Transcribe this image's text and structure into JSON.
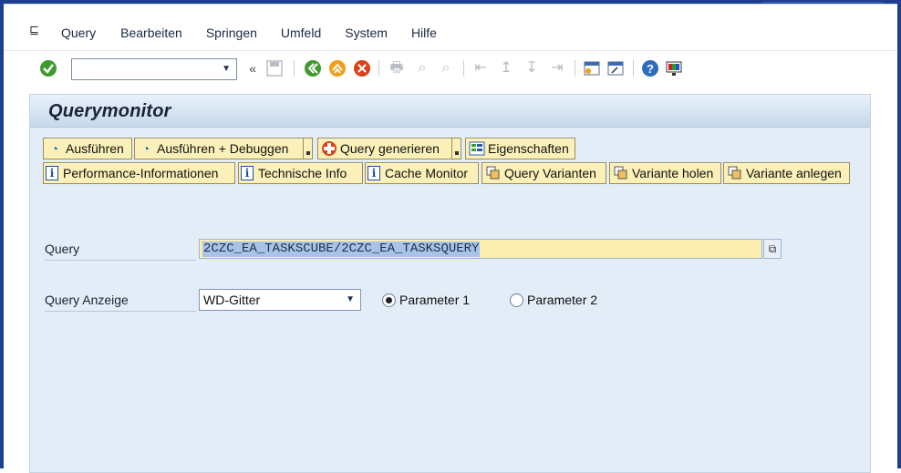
{
  "menu": {
    "items": [
      "Query",
      "Bearbeiten",
      "Springen",
      "Umfeld",
      "System",
      "Hilfe"
    ]
  },
  "window_controls": {
    "minimize_icon": "minimize-icon",
    "maximize_icon": "maximize-icon",
    "close_icon": "close-icon"
  },
  "toolbar": {
    "command_field_value": "",
    "icons": [
      "enter-check-icon",
      "back-icon",
      "exit-icon",
      "cancel-icon",
      "print-icon",
      "find-icon",
      "find-next-icon",
      "first-page-icon",
      "previous-page-icon",
      "next-page-icon",
      "last-page-icon",
      "create-session-icon",
      "shortcut-icon",
      "help-icon",
      "customize-layout-icon"
    ]
  },
  "screen": {
    "title": "Querymonitor"
  },
  "buttons_row1": [
    {
      "label": "Ausführen",
      "icon": "execute-icon"
    },
    {
      "label": "Ausführen + Debuggen",
      "icon": "execute-debug-icon"
    },
    {
      "label": "Query generieren",
      "icon": "generate-icon"
    },
    {
      "label": "Eigenschaften",
      "icon": "properties-icon"
    }
  ],
  "buttons_row2": [
    {
      "label": "Performance-Informationen",
      "icon": "info-icon"
    },
    {
      "label": "Technische Info",
      "icon": "info-icon"
    },
    {
      "label": "Cache Monitor",
      "icon": "info-icon"
    },
    {
      "label": "Query Varianten",
      "icon": "variant-icon"
    },
    {
      "label": "Variante holen",
      "icon": "variant-icon"
    },
    {
      "label": "Variante anlegen",
      "icon": "variant-icon"
    }
  ],
  "form": {
    "query_label": "Query",
    "query_value": "2CZC_EA_TASKSCUBE/2CZC_EA_TASKSQUERY",
    "anzeige_label": "Query Anzeige",
    "anzeige_value": "WD-Gitter",
    "radio1_label": "Parameter 1",
    "radio1_checked": true,
    "radio2_label": "Parameter 2",
    "radio2_checked": false
  },
  "colors": {
    "frame": "#1c3f8f",
    "button_bg": "#fbf1b8",
    "content_bg": "#e3edf8",
    "field_bg": "#fbeeb0"
  }
}
